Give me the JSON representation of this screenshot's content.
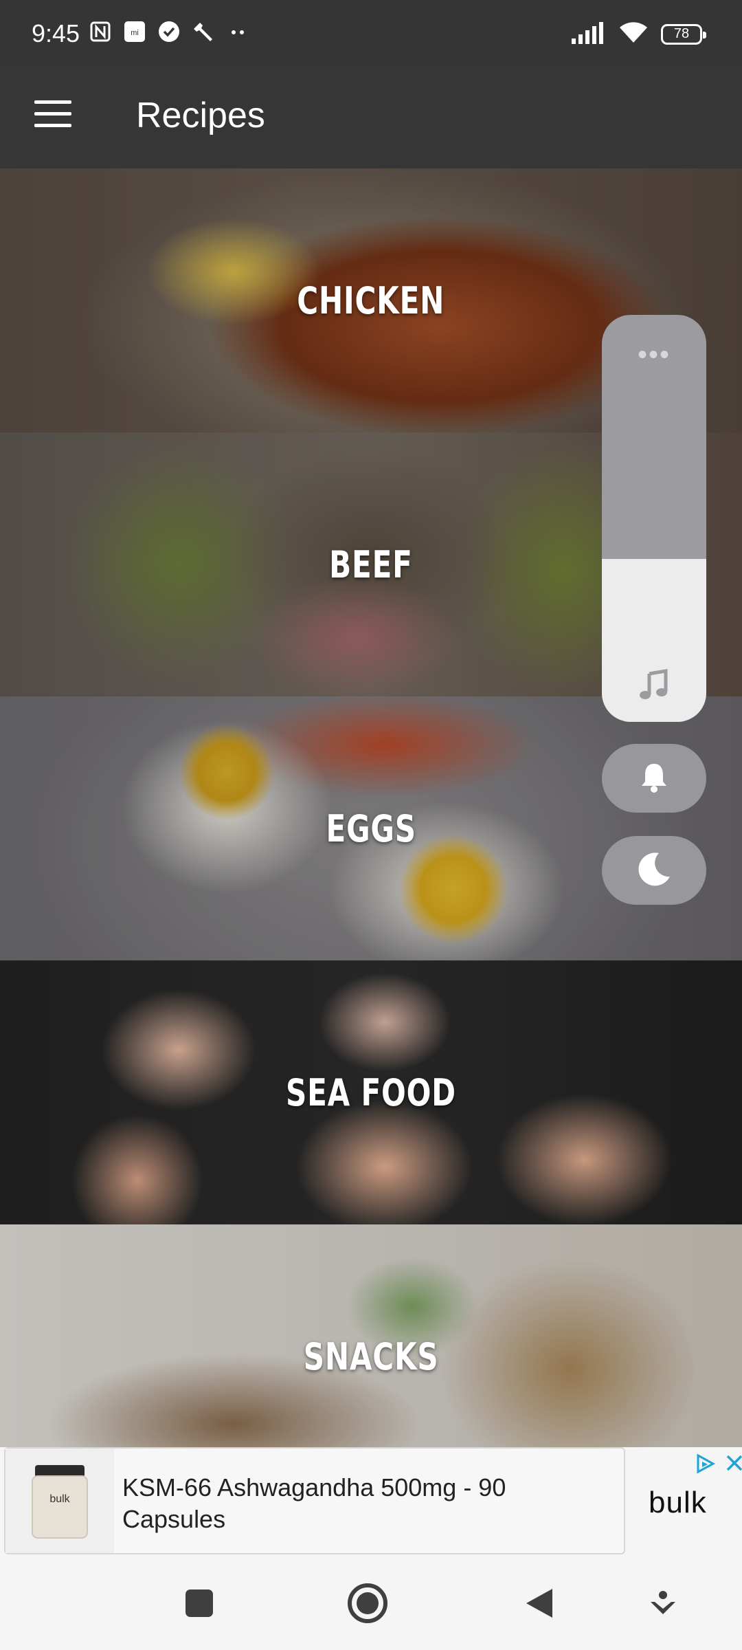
{
  "status_bar": {
    "time": "9:45",
    "battery": "78",
    "left_icons": [
      "nfc-icon",
      "mi-icon",
      "check-circle-icon",
      "wrench-icon",
      "more-dots-icon"
    ],
    "right_icons": [
      "signal-icon",
      "wifi-icon",
      "battery-icon"
    ]
  },
  "app_bar": {
    "title": "Recipes",
    "menu_icon": "hamburger-menu-icon"
  },
  "categories": [
    {
      "label": "CHICKEN"
    },
    {
      "label": "BEEF"
    },
    {
      "label": "EGGS"
    },
    {
      "label": "SEA FOOD"
    },
    {
      "label": "SNACKS"
    }
  ],
  "volume_panel": {
    "level": 0.4,
    "icons": [
      "more-icon",
      "music-note-icon",
      "bell-icon",
      "moon-icon"
    ]
  },
  "ad": {
    "text": "KSM-66 Ashwagandha 500mg - 90 Capsules",
    "brand": "bulk",
    "product_label": "bulk",
    "icons": [
      "adchoices-icon",
      "close-icon"
    ],
    "accent": "#1fa3d9"
  },
  "nav_bar": {
    "icons": [
      "recents-square-icon",
      "home-circle-icon",
      "back-triangle-icon",
      "assistant-icon"
    ]
  }
}
